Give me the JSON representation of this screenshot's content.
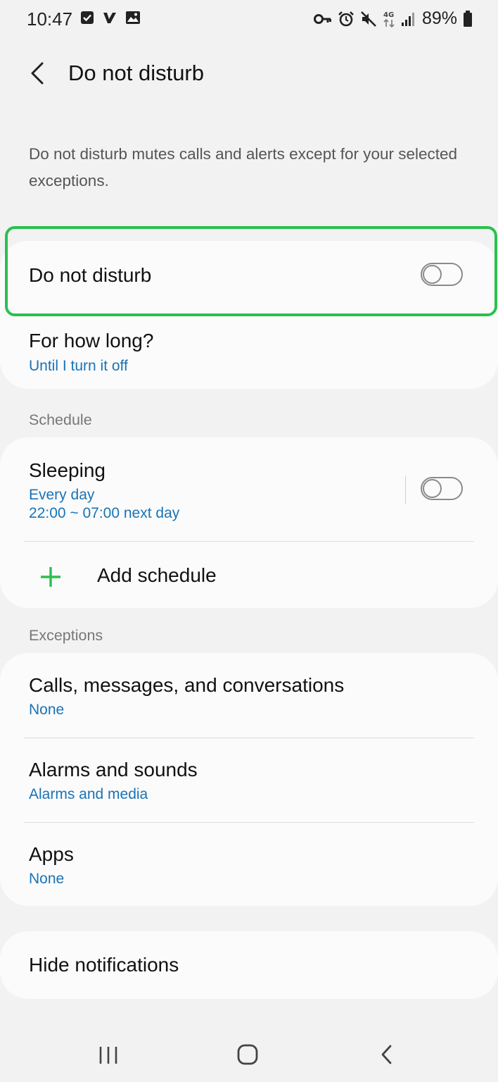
{
  "status_bar": {
    "time": "10:47",
    "left_icons": [
      "checkbox-notification-icon",
      "verified-app-icon",
      "gallery-icon"
    ],
    "right_icons": [
      "vpn-key-icon",
      "alarm-icon",
      "mute-icon",
      "4g-data-icon",
      "signal-icon",
      "battery-icon"
    ],
    "network_label": "4G",
    "battery": "89%"
  },
  "header": {
    "title": "Do not disturb"
  },
  "description": "Do not disturb mutes calls and alerts except for your selected exceptions.",
  "main_toggle": {
    "label": "Do not disturb",
    "enabled": false
  },
  "duration": {
    "title": "For how long?",
    "value": "Until I turn it off"
  },
  "schedule": {
    "header": "Schedule",
    "items": [
      {
        "title": "Sleeping",
        "days": "Every day",
        "time": "22:00 ~ 07:00 next day",
        "enabled": false
      }
    ],
    "add_label": "Add schedule"
  },
  "exceptions": {
    "header": "Exceptions",
    "items": [
      {
        "title": "Calls, messages, and conversations",
        "value": "None"
      },
      {
        "title": "Alarms and sounds",
        "value": "Alarms and media"
      },
      {
        "title": "Apps",
        "value": "None"
      }
    ]
  },
  "hide_notifications": {
    "title": "Hide notifications"
  },
  "colors": {
    "accent_green": "#2bc04f",
    "link_blue": "#1a73b5",
    "background": "#f2f2f2",
    "card": "#fbfbfb"
  },
  "nav_bar": {
    "icons": [
      "recent-apps-icon",
      "home-icon",
      "back-icon"
    ]
  }
}
